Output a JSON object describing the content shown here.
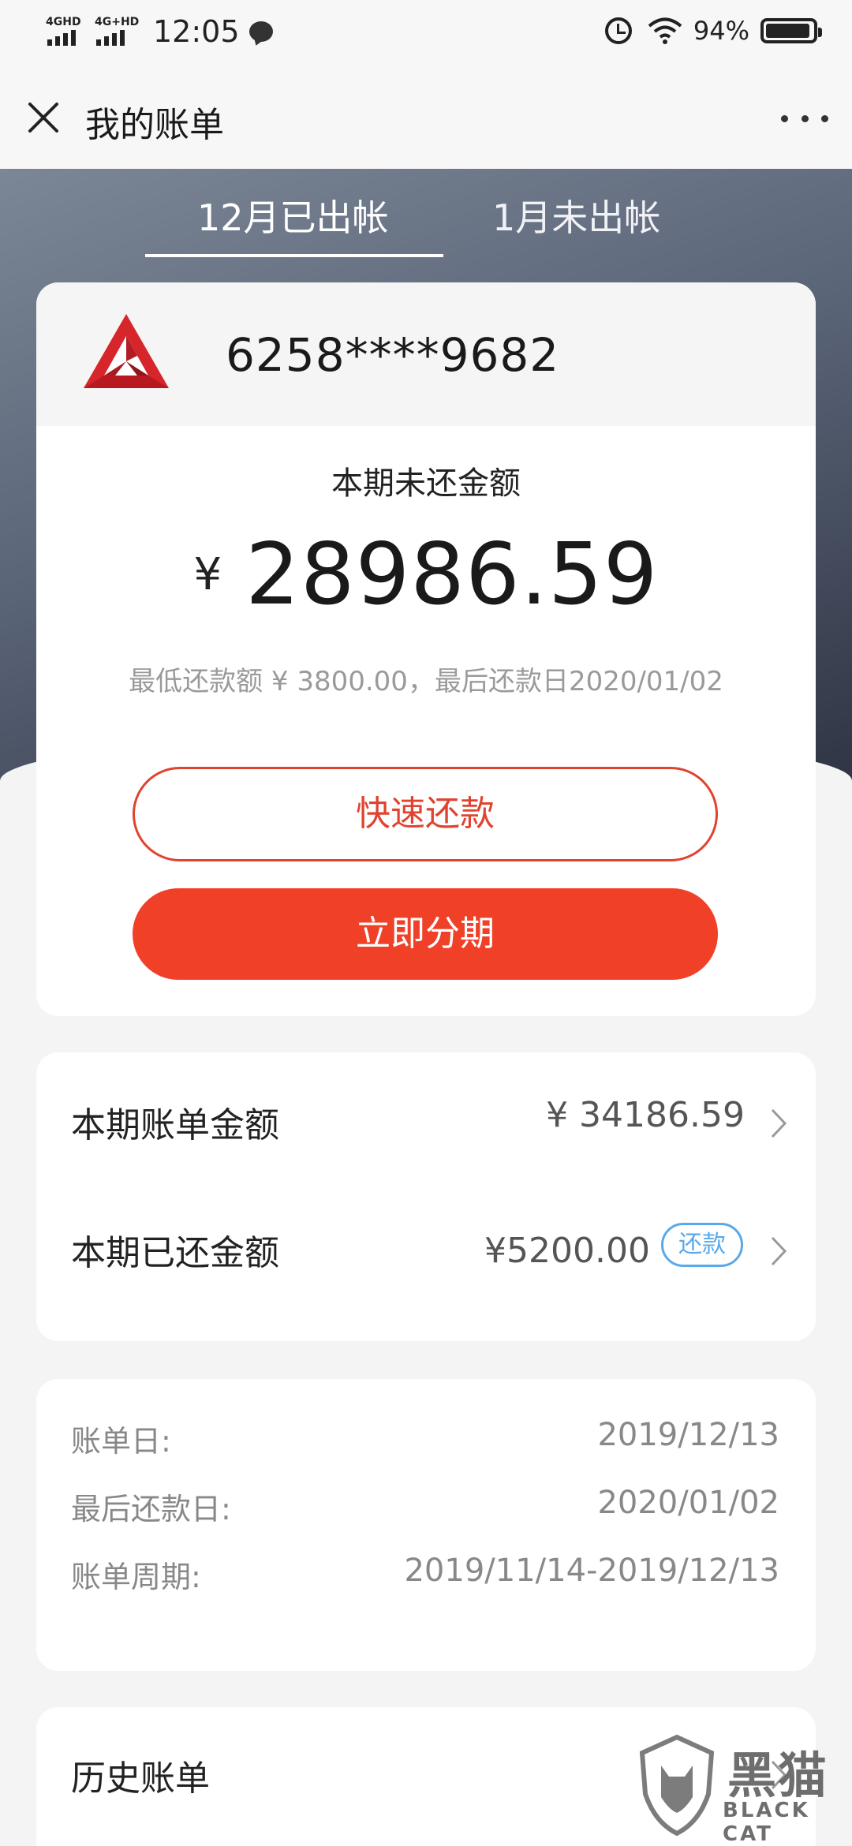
{
  "status_bar": {
    "signal1": "4GHD",
    "signal2": "4G+HD",
    "time": "12:05",
    "battery": "94%",
    "battery_level": 0.94
  },
  "header": {
    "title": "我的账单"
  },
  "tabs": [
    {
      "label": "12月已出帐",
      "active": true
    },
    {
      "label": "1月未出帐",
      "active": false
    }
  ],
  "card": {
    "number": "6258****9682",
    "unpaid_label": "本期未还金额",
    "currency": "¥",
    "unpaid_amount": "28986.59",
    "min_payment_text": "最低还款额 ¥ 3800.00，最后还款日2020/01/02",
    "quick_pay_label": "快速还款",
    "installment_label": "立即分期"
  },
  "amounts": {
    "bill_label": "本期账单金额",
    "bill_value": "¥ 34186.59",
    "paid_label": "本期已还金额",
    "paid_value": "¥5200.00",
    "paid_tag": "还款"
  },
  "dates": [
    {
      "label": "账单日:",
      "value": "2019/12/13"
    },
    {
      "label": "最后还款日:",
      "value": "2020/01/02"
    },
    {
      "label": "账单周期:",
      "value": "2019/11/14-2019/12/13"
    }
  ],
  "history": {
    "label": "历史账单"
  },
  "watermark": {
    "cn": "黑猫",
    "en": "BLACK CAT"
  },
  "colors": {
    "accent": "#f04128",
    "link_blue": "#5aa9e8",
    "band_dark": "#2d3342"
  }
}
